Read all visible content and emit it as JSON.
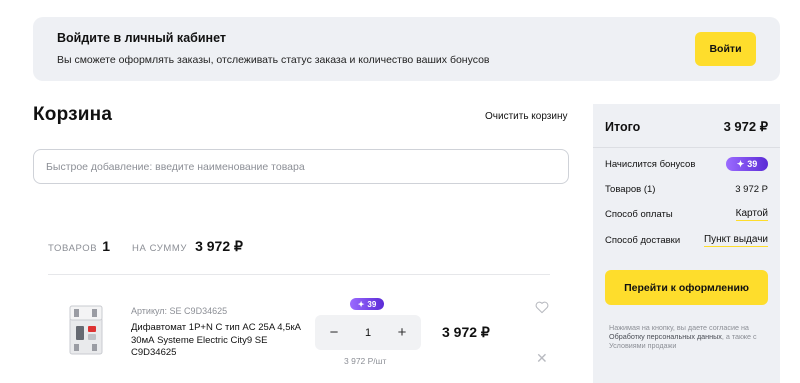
{
  "login_banner": {
    "title": "Войдите в личный кабинет",
    "subtitle": "Вы сможете оформлять заказы, отслеживать статус заказа и количество ваших бонусов",
    "button_label": "Войти"
  },
  "cart": {
    "title": "Корзина",
    "clear_label": "Очистить корзину",
    "quick_add_placeholder": "Быстрое добавление: введите наименование товара",
    "items_label": "ТОВАРОВ",
    "items_count": "1",
    "sum_label": "НА СУММУ",
    "sum_value": "3 972 ₽"
  },
  "items": [
    {
      "sku": "Артикул: SE C9D34625",
      "name": "Дифавтомат 1P+N C тип AC 25A 4,5кА 30мА Systeme Electric City9 SE C9D34625",
      "bonus": "39",
      "quantity": "1",
      "price": "3 972 ₽",
      "unit_price": "3 972 Р/шт"
    }
  ],
  "summary": {
    "title": "Итого",
    "total": "3 972 ₽",
    "bonus_label": "Начислится бонусов",
    "bonus_value": "39",
    "items_label": "Товаров (1)",
    "items_value": "3 972 Р",
    "payment_label": "Способ оплаты",
    "payment_value": "Картой",
    "delivery_label": "Способ доставки",
    "delivery_value": "Пункт выдачи",
    "checkout_label": "Перейти к оформлению",
    "consent_pre": "Нажимая на кнопку, вы даете согласие на ",
    "consent_link1": "Обработку персональных данных",
    "consent_mid": ", а также с Условиями продажи"
  },
  "colors": {
    "accent_yellow": "#fedd2c",
    "bonus_purple": "#7b45ec",
    "panel_bg": "#eef0f4"
  }
}
